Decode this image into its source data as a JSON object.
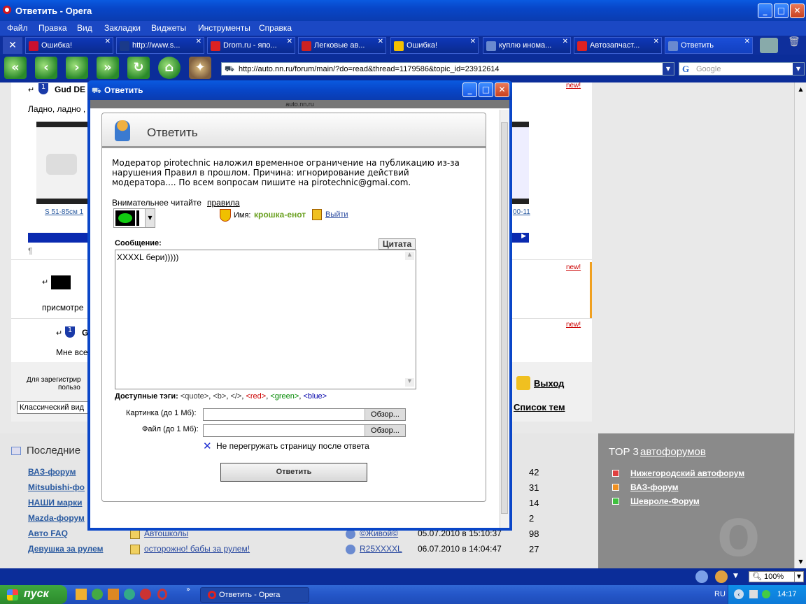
{
  "window": {
    "title": "Ответить - Opera"
  },
  "menu": [
    "Файл",
    "Правка",
    "Вид",
    "Закладки",
    "Виджеты",
    "Инструменты",
    "Справка"
  ],
  "tabs": [
    {
      "label": "Ошибка!",
      "color": "#c8102e"
    },
    {
      "label": "http://www.s...",
      "color": "#1a3a8a"
    },
    {
      "label": "Drom.ru - япо...",
      "color": "#d22"
    },
    {
      "label": "Легковые ав...",
      "color": "#c22"
    },
    {
      "label": "Ошибка!",
      "color": "#f5c000"
    },
    {
      "label": "куплю инома...",
      "color": "#6a8acf"
    },
    {
      "label": "Автозапчаст...",
      "color": "#d22"
    },
    {
      "label": "Ответить",
      "color": "#6a8acf"
    }
  ],
  "address": {
    "url": "http://auto.nn.ru/forum/main/?do=read&thread=1179586&topic_id=23912614"
  },
  "search": {
    "placeholder": "Google"
  },
  "background": {
    "post1_author": "Gud DE",
    "post1_text": "Ладно, ладно ,",
    "thumb_left_label": "S 51-85см 1",
    "thumb_right_label": "00-11",
    "pilcrow": "¶",
    "post2_text": "присмотре",
    "post3_author": "G",
    "post3_text": "Мне все",
    "new_badge": "new!",
    "reg_text_1": "Для зарегистрир",
    "reg_text_2": "пользо",
    "view_select": "Классический вид",
    "exit_link": "Выход",
    "topics_link": "Список тем",
    "last_posts_title": "Последние"
  },
  "last_posts": [
    {
      "forum": "ВАЗ-форум",
      "topic": "",
      "author": "",
      "date": "",
      "count": "42"
    },
    {
      "forum": "Mitsubishi-фо",
      "topic": "",
      "author": "",
      "date": "",
      "count": "31"
    },
    {
      "forum": "НАШИ марки",
      "topic": "",
      "author": "",
      "date": "",
      "count": "14"
    },
    {
      "forum": "Mazda-форум",
      "topic": "",
      "author": "",
      "date": "",
      "count": "2"
    },
    {
      "forum": "Авто FAQ",
      "topic": "Автошколы",
      "author": "©Живой©",
      "date": "05.07.2010 в 15:10:37",
      "count": "98"
    },
    {
      "forum": "Девушка за рулем",
      "topic": "осторожно! бабы за рулем!",
      "author": "R25XXXXL",
      "date": "06.07.2010 в 14:04:47",
      "count": "27"
    }
  ],
  "top3": {
    "title_prefix": "TOP 3",
    "title_link": "автофорумов",
    "items": [
      {
        "label": "Нижегородский автофорум",
        "color": "#e04040"
      },
      {
        "label": "ВАЗ-форум",
        "color": "#f09020"
      },
      {
        "label": "Шевроле-Форум",
        "color": "#40c040"
      }
    ]
  },
  "dialog": {
    "title": "Ответить",
    "url": "auto.nn.ru",
    "header": "Ответить",
    "warning": "Модератор pirotechnic наложил временное ограничение на публикацию из-за нарушения Правил в прошлом. Причина: игнорирование действий модератора.... По всем вопросам пишите на pirotechnic@gmai.com.",
    "rules_prefix": "Внимательнее читайте",
    "rules_link": "правила",
    "name_label": "Имя:",
    "name_value": "крошка-енот",
    "logout_link": "Выйти",
    "message_label": "Сообщение:",
    "cite_button": "Цитата",
    "message_value": "XXXXL бери)))))",
    "tags_label": "Доступные тэги:",
    "tags": [
      {
        "text": "<quote>",
        "color": "#333"
      },
      {
        "text": "<b>",
        "color": "#333"
      },
      {
        "text": "</>",
        "color": "#333"
      },
      {
        "text": "<red>",
        "color": "#c00"
      },
      {
        "text": "<green>",
        "color": "#080"
      },
      {
        "text": "<blue>",
        "color": "#00a"
      }
    ],
    "image_label": "Картинка (до 1 Мб):",
    "file_label": "Файл (до 1 Мб):",
    "browse_label": "Обзор...",
    "noreload_label": "Не перегружать страницу после ответа",
    "submit_label": "Ответить"
  },
  "status": {
    "zoom": "100%"
  },
  "taskbar": {
    "start": "пуск",
    "active_item": "Ответить - Opera",
    "lang": "RU",
    "clock": "14:17"
  }
}
